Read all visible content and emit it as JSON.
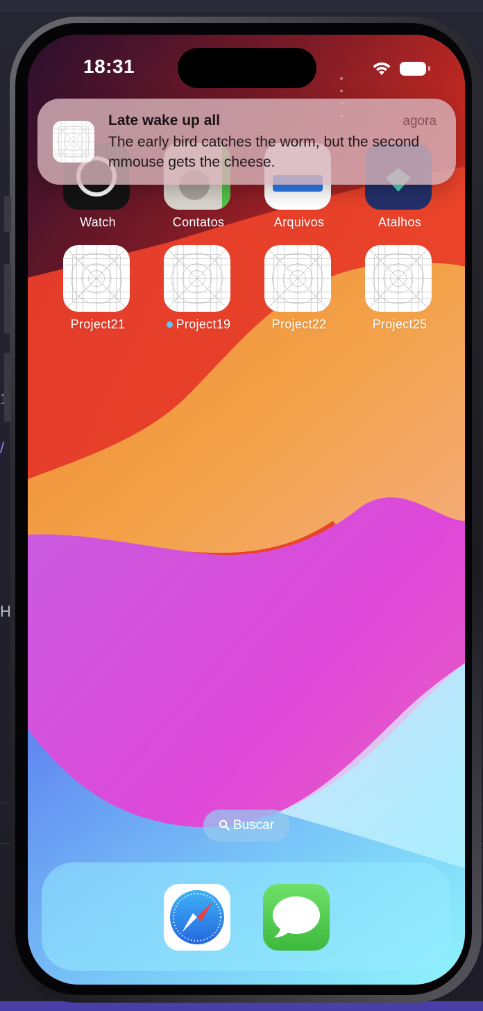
{
  "status_bar": {
    "time": "18:31",
    "wifi_icon": "wifi-icon",
    "battery_icon": "battery-icon"
  },
  "notification": {
    "title": "Late wake up all",
    "time": "agora",
    "body": "The early bird catches the worm, but the second mmouse gets the cheese.",
    "icon": "app-placeholder-icon"
  },
  "home_screen": {
    "row1": [
      {
        "label": "Watch",
        "icon": "watch-app-icon"
      },
      {
        "label": "Contatos",
        "icon": "contacts-app-icon"
      },
      {
        "label": "Arquivos",
        "icon": "files-app-icon"
      },
      {
        "label": "Atalhos",
        "icon": "shortcuts-app-icon"
      }
    ],
    "row2": [
      {
        "label": "Project21",
        "icon": "app-placeholder-icon",
        "new": false
      },
      {
        "label": "Project19",
        "icon": "app-placeholder-icon",
        "new": true
      },
      {
        "label": "Project22",
        "icon": "app-placeholder-icon",
        "new": false
      },
      {
        "label": "Project25",
        "icon": "app-placeholder-icon",
        "new": false
      }
    ]
  },
  "search": {
    "label": "Buscar",
    "icon": "magnifier-icon"
  },
  "dock": {
    "apps": [
      {
        "name": "Safari",
        "icon": "safari-compass-icon"
      },
      {
        "name": "Mensagens",
        "icon": "messages-bubble-icon"
      }
    ]
  },
  "colors": {
    "notification_bg": "#d6b2ba",
    "new_dot": "#5ac8fa",
    "messages_green": "#5fd35a",
    "safari_blue": "#2f8bf0"
  }
}
